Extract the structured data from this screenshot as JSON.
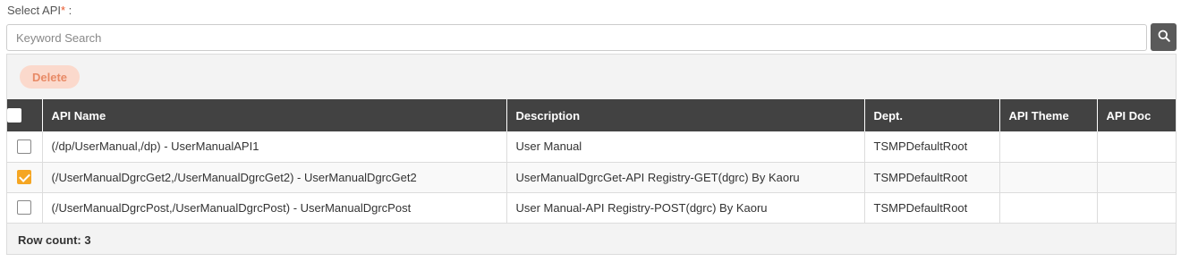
{
  "field": {
    "label": "Select API",
    "required_mark": "*",
    "suffix": " :"
  },
  "search": {
    "placeholder": "Keyword Search",
    "value": "",
    "button_icon": "search-icon"
  },
  "toolbar": {
    "delete_label": "Delete"
  },
  "table": {
    "columns": [
      "API Name",
      "Description",
      "Dept.",
      "API Theme",
      "API Doc"
    ],
    "rows": [
      {
        "checked": false,
        "api_name": "(/dp/UserManual,/dp) - UserManualAPI1",
        "description": "User Manual",
        "dept": "TSMPDefaultRoot",
        "api_theme": "",
        "api_doc": ""
      },
      {
        "checked": true,
        "api_name": "(/UserManualDgrcGet2,/UserManualDgrcGet2) - UserManualDgrcGet2",
        "description": "UserManualDgrcGet-API Registry-GET(dgrc) By Kaoru",
        "dept": "TSMPDefaultRoot",
        "api_theme": "",
        "api_doc": ""
      },
      {
        "checked": false,
        "api_name": "(/UserManualDgrcPost,/UserManualDgrcPost) - UserManualDgrcPost",
        "description": "User Manual-API Registry-POST(dgrc) By Kaoru",
        "dept": "TSMPDefaultRoot",
        "api_theme": "",
        "api_doc": ""
      }
    ]
  },
  "footer": {
    "row_count": "Row count: 3"
  },
  "colors": {
    "header_bg": "#424242",
    "accent_checkbox": "#f5a623",
    "delete_bg": "#fbd9cc",
    "delete_text": "#e88a66",
    "required_mark": "#e8562a"
  }
}
